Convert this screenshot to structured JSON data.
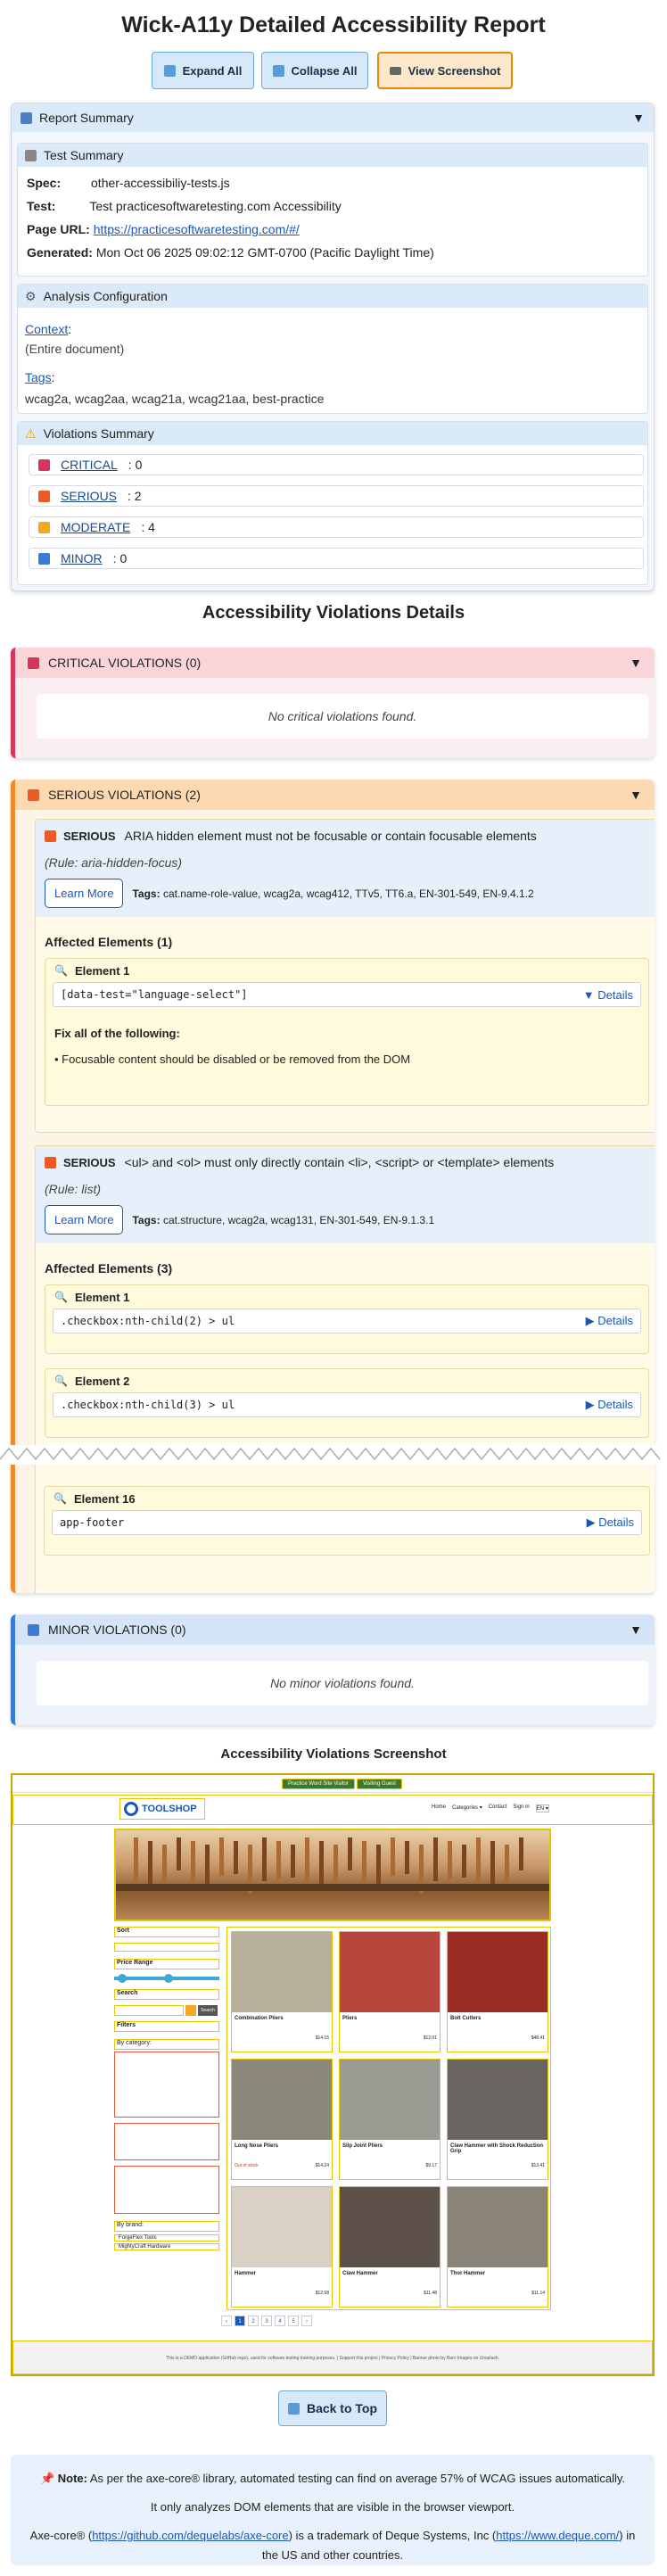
{
  "title": "Wick-A11y Detailed Accessibility Report",
  "toolbar": {
    "expand_all": "Expand All",
    "collapse_all": "Collapse All",
    "view_screenshot": "View Screenshot"
  },
  "report_summary": {
    "title": "Report Summary",
    "test_summary": {
      "title": "Test Summary",
      "spec_label": "Spec:",
      "spec": "other-accessibiliy-tests.js",
      "test_label": "Test:",
      "test": "Test practicesoftwaretesting.com Accessibility",
      "url_label": "Page URL:",
      "url": "https://practicesoftwaretesting.com/#/",
      "generated_label": "Generated:",
      "generated": "Mon Oct 06 2025 09:02:12 GMT-0700 (Pacific Daylight Time)"
    },
    "analysis": {
      "title": "Analysis Configuration",
      "context_label": "Context",
      "context_colon": ":",
      "context": "(Entire document)",
      "tags_label": "Tags",
      "tags_colon": ":",
      "tags": "wcag2a, wcag2aa, wcag21a, wcag21aa, best-practice"
    },
    "violations": {
      "title": "Violations Summary",
      "items": [
        {
          "label": "CRITICAL",
          "count": ": 0",
          "color": "#d6365c"
        },
        {
          "label": "SERIOUS",
          "count": ": 2",
          "color": "#ee5a24"
        },
        {
          "label": "MODERATE",
          "count": ": 4",
          "color": "#f5a623"
        },
        {
          "label": "MINOR",
          "count": ": 0",
          "color": "#3a7bd5"
        }
      ]
    }
  },
  "details_title": "Accessibility Violations Details",
  "critical": {
    "title": "CRITICAL VIOLATIONS (0)",
    "empty": "No critical violations found."
  },
  "serious": {
    "title": "SERIOUS VIOLATIONS (2)",
    "violations": [
      {
        "severity": "SERIOUS",
        "title": "ARIA hidden element must not be focusable or contain focusable elements",
        "rule": "(Rule: aria-hidden-focus)",
        "learn_more": "Learn More",
        "tags_label": "Tags:",
        "tags": "cat.name-role-value, wcag2a, wcag412, TTv5, TT6.a, EN-301-549, EN-9.4.1.2",
        "affected_title": "Affected Elements (1)",
        "elements": [
          {
            "label": "Element 1",
            "selector": "[data-test=\"language-select\"]",
            "details": "▼ Details"
          }
        ],
        "fix_title": "Fix all of the following:",
        "fix_item": "• Focusable content should be disabled or be removed from the DOM"
      },
      {
        "severity": "SERIOUS",
        "title": "<ul> and <ol> must only directly contain <li>, <script> or <template> elements",
        "rule": "(Rule: list)",
        "learn_more": "Learn More",
        "tags_label": "Tags:",
        "tags": "cat.structure, wcag2a, wcag131, EN-301-549, EN-9.1.3.1",
        "affected_title": "Affected Elements (3)",
        "elements": [
          {
            "label": "Element 1",
            "selector": ".checkbox:nth-child(2) > ul",
            "details": "▶ Details"
          },
          {
            "label": "Element 2",
            "selector": ".checkbox:nth-child(3) > ul",
            "details": "▶ Details"
          },
          {
            "label": "Element 16",
            "selector": "app-footer",
            "details": "▶ Details"
          }
        ]
      }
    ]
  },
  "minor": {
    "title": "MINOR VIOLATIONS (0)",
    "empty": "No minor violations found."
  },
  "screenshot": {
    "title": "Accessibility Violations Screenshot",
    "site": {
      "banner": "Practice Word Site Visitor",
      "banner_btn": "Visiting Guest",
      "logo": "TOOLSHOP",
      "nav": [
        "Home",
        "Categories ▾",
        "Contact",
        "Sign in",
        "EN ▾"
      ],
      "sort": "Sort",
      "price_range": "Price Range",
      "search": "Search",
      "search_btn": "Search",
      "filters": "Filters",
      "by_category": "By category:",
      "by_brand": "By brand:",
      "brands": [
        "ForgeFlex Tools",
        "MightyCraft Hardware"
      ],
      "products": [
        {
          "name": "Combination Pliers",
          "price": "$14.15"
        },
        {
          "name": "Pliers",
          "price": "$12.01"
        },
        {
          "name": "Bolt Cutters",
          "price": "$48.41"
        },
        {
          "name": "Long Nose Pliers",
          "price": "$14.24",
          "stock": "Out of stock"
        },
        {
          "name": "Slip Joint Pliers",
          "price": "$9.17"
        },
        {
          "name": "Claw Hammer with Shock Reduction Grip",
          "price": "$13.41"
        },
        {
          "name": "Hammer",
          "price": "$12.58"
        },
        {
          "name": "Claw Hammer",
          "price": "$11.48"
        },
        {
          "name": "Thor Hammer",
          "price": "$11.14"
        }
      ],
      "pages": [
        "‹",
        "1",
        "2",
        "3",
        "4",
        "5",
        "›"
      ],
      "footer": "This is a DEMO application (GitHub repo), used for software testing training purposes. | Support this project | Privacy Policy | Banner photo by Barn Images on Unsplash."
    }
  },
  "back_to_top": "Back to Top",
  "note": {
    "label": "Note:",
    "line1": "As per the axe-core® library, automated testing can find on average 57% of WCAG issues automatically.",
    "line2": "It only analyzes DOM elements that are visible in the browser viewport.",
    "line3_pre": "Axe-core® (",
    "line3_link1": "https://github.com/dequelabs/axe-core",
    "line3_mid": ") is a trademark of Deque Systems, Inc (",
    "line3_link2": "https://www.deque.com/",
    "line3_post": ") in the US and other countries."
  }
}
